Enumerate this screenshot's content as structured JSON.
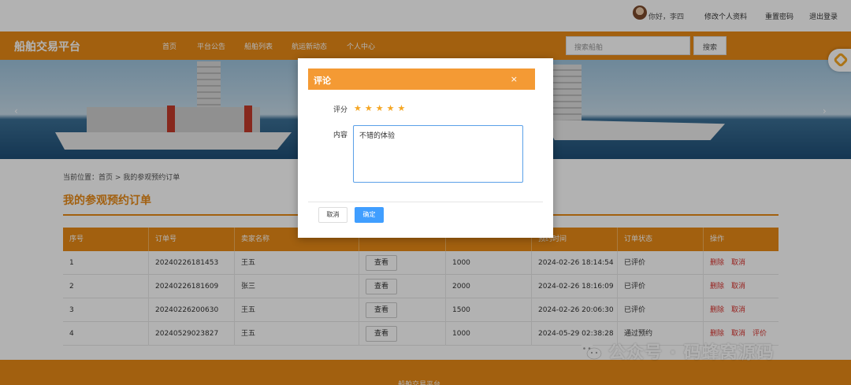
{
  "topbar": {
    "greeting": "你好，李四",
    "links": [
      "修改个人资料",
      "重置密码",
      "退出登录"
    ]
  },
  "nav": {
    "brand": "船舶交易平台",
    "items": [
      "首页",
      "平台公告",
      "船舶列表",
      "航运新动态",
      "个人中心"
    ],
    "search_placeholder": "搜索船舶",
    "search_button": "搜索"
  },
  "banner": {
    "prev": "‹",
    "next": "›"
  },
  "breadcrumb": {
    "prefix": "当前位置：",
    "home": "首页",
    "sep": " > ",
    "current": "我的参观预约订单"
  },
  "page_title": "我的参观预约订单",
  "table": {
    "headers": [
      "序号",
      "订单号",
      "卖家名称",
      "",
      "",
      "预约时间",
      "订单状态",
      "操作"
    ],
    "view_label": "查看",
    "rows": [
      {
        "no": "1",
        "order": "20240226181453",
        "seller": "王五",
        "amount": "1000",
        "time": "2024-02-26 18:14:54",
        "status": "已评价",
        "actions": [
          "删除",
          "取消"
        ]
      },
      {
        "no": "2",
        "order": "20240226181609",
        "seller": "张三",
        "amount": "2000",
        "time": "2024-02-26 18:16:09",
        "status": "已评价",
        "actions": [
          "删除",
          "取消"
        ]
      },
      {
        "no": "3",
        "order": "20240226200630",
        "seller": "王五",
        "amount": "1500",
        "time": "2024-02-26 20:06:30",
        "status": "已评价",
        "actions": [
          "删除",
          "取消"
        ]
      },
      {
        "no": "4",
        "order": "20240529023827",
        "seller": "王五",
        "amount": "1000",
        "time": "2024-05-29 02:38:28",
        "status": "通过预约",
        "actions": [
          "删除",
          "取消",
          "评价"
        ]
      }
    ]
  },
  "footer": {
    "text": "船舶交易平台"
  },
  "watermark": {
    "text": "公众号 · 码蜂窝源码"
  },
  "modal": {
    "title": "评论",
    "close": "×",
    "rating_label": "评分",
    "rating": 5,
    "stars": "★★★★★",
    "content_label": "内容",
    "content_value": "不错的体验",
    "cancel": "取消",
    "confirm": "确定"
  }
}
